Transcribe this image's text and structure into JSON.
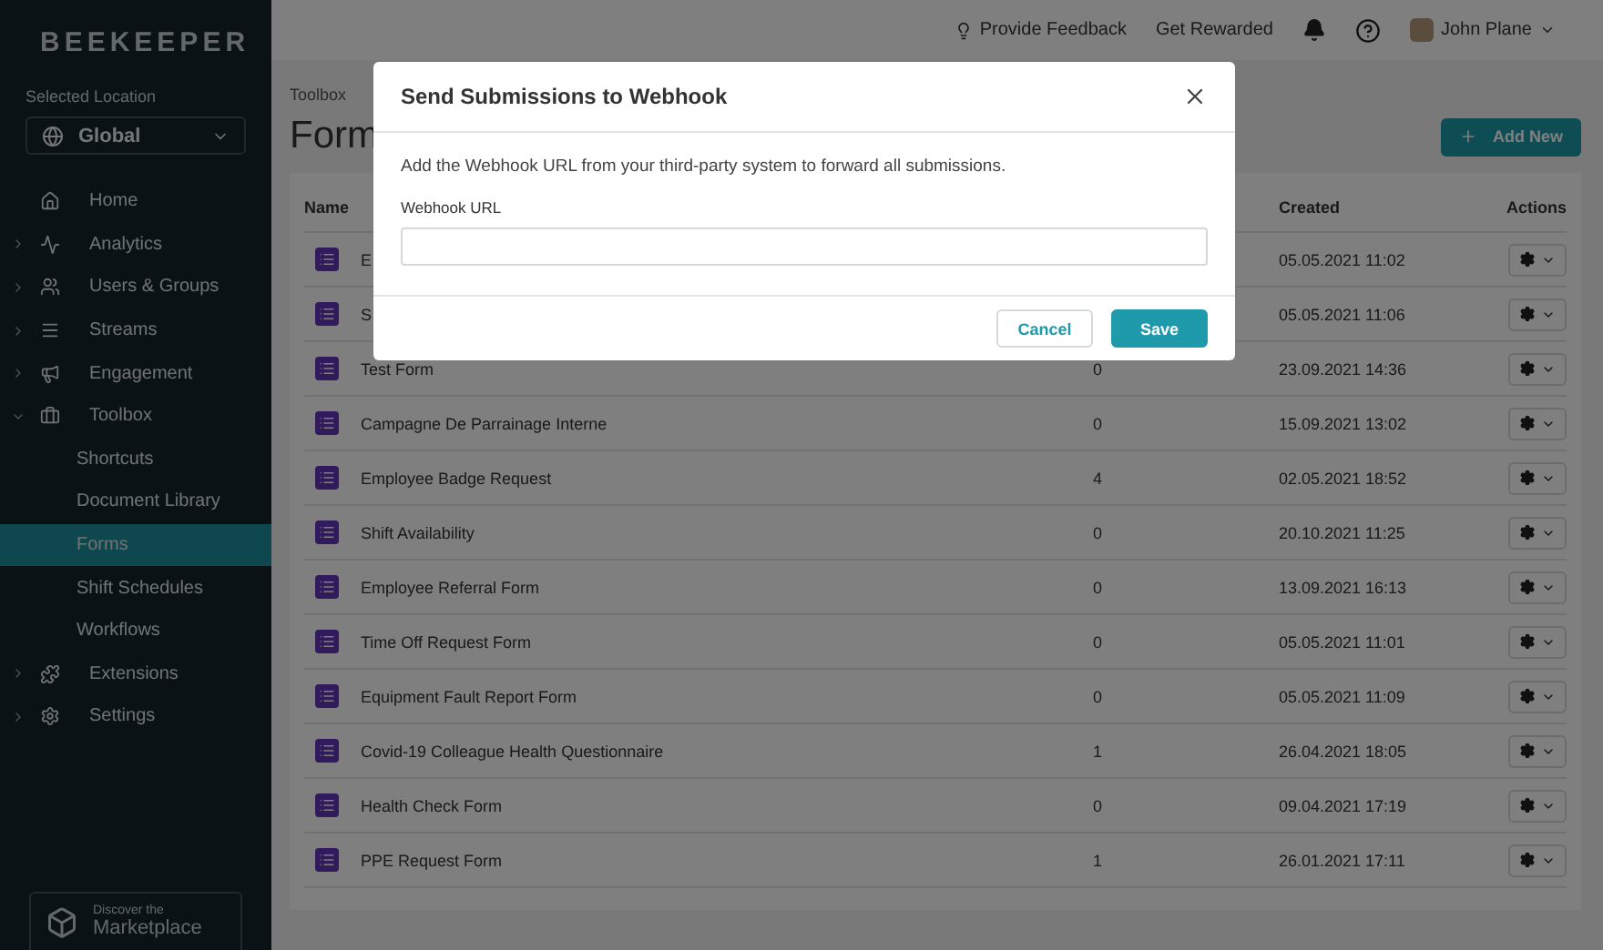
{
  "sidebar": {
    "logo": "BEEKEEPER",
    "location_label": "Selected Location",
    "location": "Global",
    "items": [
      {
        "label": "Home"
      },
      {
        "label": "Analytics",
        "expanded": false
      },
      {
        "label": "Users & Groups",
        "expanded": false
      },
      {
        "label": "Streams",
        "expanded": false
      },
      {
        "label": "Engagement",
        "expanded": false
      },
      {
        "label": "Toolbox",
        "expanded": true,
        "children": [
          {
            "label": "Shortcuts",
            "selected": false
          },
          {
            "label": "Document Library",
            "selected": false
          },
          {
            "label": "Forms",
            "selected": true
          },
          {
            "label": "Shift Schedules",
            "selected": false
          },
          {
            "label": "Workflows",
            "selected": false
          }
        ]
      },
      {
        "label": "Extensions",
        "expanded": false
      },
      {
        "label": "Settings",
        "expanded": false
      }
    ],
    "marketplace": {
      "line_1": "Discover the",
      "line_2": "Marketplace"
    }
  },
  "top_bar": {
    "feedback": "Provide Feedback",
    "rewards": "Get Rewarded",
    "user": "John Plane"
  },
  "breadcrumb": "Toolbox",
  "page_title": "Form",
  "add_button": "Add New",
  "table": {
    "columns": [
      "Name",
      "Created",
      "Actions"
    ],
    "rows": [
      {
        "name": "E",
        "count": "",
        "created": "05.05.2021 11:02"
      },
      {
        "name": "S",
        "count": "",
        "created": "05.05.2021 11:06"
      },
      {
        "name": "Test Form",
        "count": "0",
        "created": "23.09.2021 14:36"
      },
      {
        "name": "Campagne De Parrainage Interne",
        "count": "0",
        "created": "15.09.2021 13:02"
      },
      {
        "name": "Employee Badge Request",
        "count": "4",
        "created": "02.05.2021 18:52"
      },
      {
        "name": "Shift Availability",
        "count": "0",
        "created": "20.10.2021 11:25"
      },
      {
        "name": "Employee Referral Form",
        "count": "0",
        "created": "13.09.2021 16:13"
      },
      {
        "name": "Time Off Request Form",
        "count": "0",
        "created": "05.05.2021 11:01"
      },
      {
        "name": "Equipment Fault Report Form",
        "count": "0",
        "created": "05.05.2021 11:09"
      },
      {
        "name": "Covid-19 Colleague Health Questionnaire",
        "count": "1",
        "created": "26.04.2021 18:05"
      },
      {
        "name": "Health Check Form",
        "count": "0",
        "created": "09.04.2021 17:19"
      },
      {
        "name": "PPE Request Form",
        "count": "1",
        "created": "26.01.2021 17:11"
      }
    ]
  },
  "dialog": {
    "title": "Send Submissions to Webhook",
    "text": "Add the Webhook URL from your third-party system to forward all submissions.",
    "field_label": "Webhook URL",
    "buttons": [
      "Cancel",
      "Save"
    ]
  }
}
